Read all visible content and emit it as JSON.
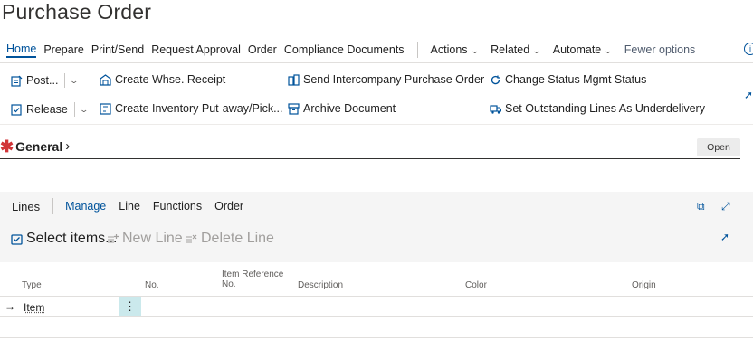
{
  "page": {
    "title": "Purchase Order"
  },
  "action_bar": {
    "tabs": [
      "Home",
      "Prepare",
      "Print/Send",
      "Request Approval",
      "Order",
      "Compliance Documents"
    ],
    "drops": [
      "Actions",
      "Related",
      "Automate"
    ],
    "fewer": "Fewer options"
  },
  "actions": {
    "post": "Post...",
    "release": "Release",
    "create_whse_receipt": "Create Whse. Receipt",
    "create_inventory_putaway": "Create Inventory Put-away/Pick...",
    "send_intercompany": "Send Intercompany Purchase Order",
    "archive_document": "Archive Document",
    "change_status": "Change Status Mgmt Status",
    "set_outstanding": "Set Outstanding Lines As Underdelivery"
  },
  "general": {
    "title": "General",
    "open_label": "Open"
  },
  "lines": {
    "title": "Lines",
    "tabs": [
      "Manage",
      "Line",
      "Functions",
      "Order"
    ],
    "actions": {
      "select_items": "Select items...",
      "new_line": "New Line",
      "delete_line": "Delete Line"
    },
    "columns": {
      "type": "Type",
      "no": "No.",
      "item_reference_1": "Item Reference",
      "item_reference_2": "No.",
      "description": "Description",
      "color": "Color",
      "origin": "Origin"
    },
    "rows": [
      {
        "type": "Item"
      }
    ]
  },
  "colors": {
    "accent": "#00539b",
    "required": "#d13438",
    "selected_cell": "#cbe9ec"
  }
}
